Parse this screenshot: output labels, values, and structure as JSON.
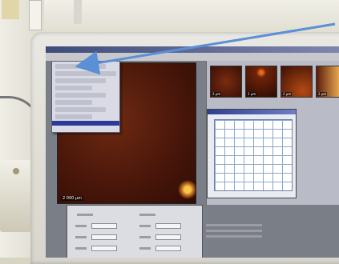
{
  "scene": {
    "description_tags": [
      "photo-of-monitor",
      "microscopy-software"
    ]
  },
  "main_image": {
    "scale_label": "2 000 µm"
  },
  "thumbnails": [
    {
      "label": "2 µm"
    },
    {
      "label": "2 µm"
    },
    {
      "label": "2 µm"
    },
    {
      "label": "2 µm"
    }
  ],
  "colors": {
    "arrow": "#5b8fd6",
    "menu_selected": "#2b3a9a"
  },
  "icons": {
    "annotation_arrow": "arrow-icon"
  }
}
